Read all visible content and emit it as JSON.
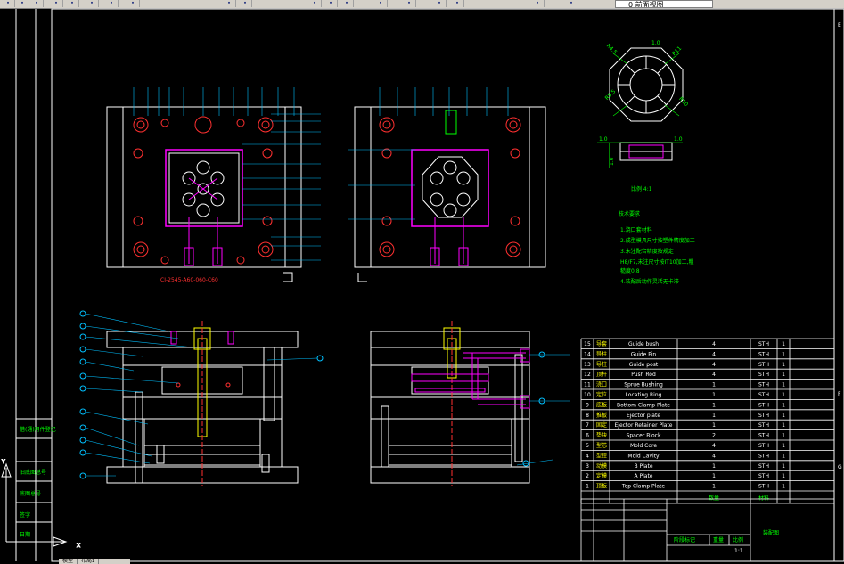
{
  "toolbar": {
    "layer_name": "0 前面视图",
    "layer_icon": "layer-properties-icon"
  },
  "drawing": {
    "part_code": "CI-2545-A60-060-C60",
    "detail_scale_label": "比例 4:1",
    "detail_dims": {
      "top": "1.0",
      "r45": "R4.5",
      "r11": "R11",
      "r55": "R5.5",
      "r10": "R10",
      "side_top_left": "1.0",
      "side_top_right": "1.0",
      "side_left": "1.0"
    },
    "tech_title": "技术要求",
    "tech_notes": [
      "1.浇口套材料",
      "2.成型模具尺寸按塑件精度加工",
      "3.未注配合精度按规定",
      "H8/F7,未注尺寸按IT10加工,粗",
      "糙度0.8",
      "4.装配后动作灵活无卡滞"
    ],
    "bom": [
      {
        "no": "15",
        "cn": "导套",
        "name": "Guide bush",
        "qty": "4",
        "mat": "STH",
        "n": "1"
      },
      {
        "no": "14",
        "cn": "导柱",
        "name": "Guide Pin",
        "qty": "4",
        "mat": "STH",
        "n": "1"
      },
      {
        "no": "13",
        "cn": "导柱",
        "name": "Guide post",
        "qty": "4",
        "mat": "STH",
        "n": "1"
      },
      {
        "no": "12",
        "cn": "顶杆",
        "name": "Push Rod",
        "qty": "4",
        "mat": "STH",
        "n": "1"
      },
      {
        "no": "11",
        "cn": "浇口",
        "name": "Sprue Bushing",
        "qty": "1",
        "mat": "STH",
        "n": "1"
      },
      {
        "no": "10",
        "cn": "定位",
        "name": "Locating Ring",
        "qty": "1",
        "mat": "STH",
        "n": "1"
      },
      {
        "no": "9",
        "cn": "底板",
        "name": "Bottom Clamp Plate",
        "qty": "1",
        "mat": "STH",
        "n": "1"
      },
      {
        "no": "8",
        "cn": "推板",
        "name": "Ejector plate",
        "qty": "1",
        "mat": "STH",
        "n": "1"
      },
      {
        "no": "7",
        "cn": "固定",
        "name": "Ejector Retainer Plate",
        "qty": "1",
        "mat": "STH",
        "n": "1"
      },
      {
        "no": "6",
        "cn": "垫块",
        "name": "Spacer Block",
        "qty": "2",
        "mat": "STH",
        "n": "1"
      },
      {
        "no": "5",
        "cn": "型芯",
        "name": "Mold Core",
        "qty": "4",
        "mat": "STH",
        "n": "1"
      },
      {
        "no": "4",
        "cn": "型腔",
        "name": "Mold Cavity",
        "qty": "4",
        "mat": "STH",
        "n": "1"
      },
      {
        "no": "3",
        "cn": "动模",
        "name": "B Plate",
        "qty": "1",
        "mat": "STH",
        "n": "1"
      },
      {
        "no": "2",
        "cn": "定模",
        "name": "A Plate",
        "qty": "1",
        "mat": "STH",
        "n": "1"
      },
      {
        "no": "1",
        "cn": "顶板",
        "name": "Top Clamp Plate",
        "qty": "1",
        "mat": "STH",
        "n": "1"
      }
    ],
    "bom_header_qty": "数量",
    "bom_header_mat": "材料",
    "title_block": {
      "scale": "1:1",
      "drawing_title": "装配图",
      "stage_label": "阶段标记",
      "weight_label": "重量",
      "ratio_label": "比例"
    },
    "side_stamps": [
      "借(通)用件登记",
      "旧底图总号",
      "底图总号",
      "签字",
      "日期"
    ],
    "border_letters_right": [
      "E",
      "F",
      "G"
    ],
    "ucs": {
      "x": "X",
      "y": "Y"
    }
  },
  "model_tabs": [
    "模型",
    "布局1"
  ],
  "colors": {
    "background": "#000000",
    "lines": "#ffffff",
    "dimensions": "#00ff00",
    "holes": "#ff3030",
    "ejector": "#ff00ff",
    "cyan": "#00c0ff",
    "yellow": "#ffff00"
  }
}
